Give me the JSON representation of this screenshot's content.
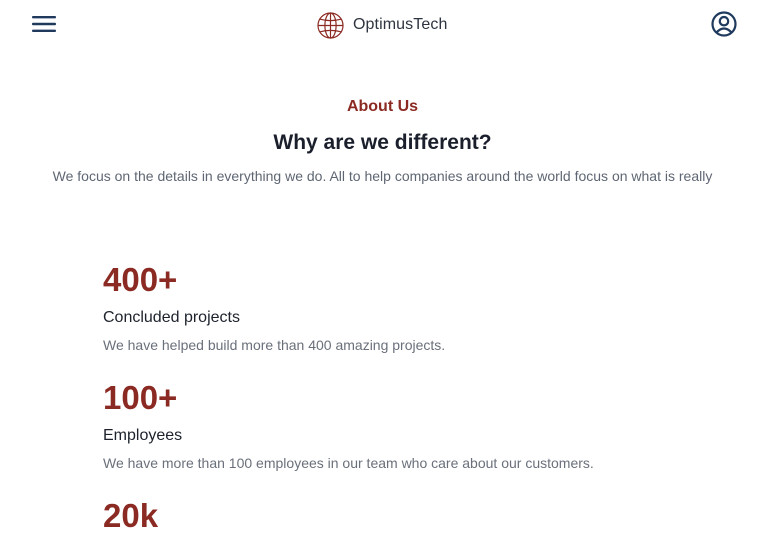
{
  "header": {
    "brand_name": "OptimusTech",
    "menu_icon": "hamburger-menu-icon",
    "logo_icon": "globe-icon",
    "account_icon": "user-circle-icon"
  },
  "hero": {
    "eyebrow": "About Us",
    "title": "Why are we different?",
    "description": "We focus on the details in everything we do. All to help companies around the world focus on what is really"
  },
  "stats": [
    {
      "value": "400+",
      "title": "Concluded projects",
      "description": "We have helped build more than 400 amazing projects."
    },
    {
      "value": "100+",
      "title": "Employees",
      "description": "We have more than 100 employees in our team who care about our customers."
    },
    {
      "value": "20k",
      "title": "",
      "description": ""
    }
  ],
  "colors": {
    "accent": "#8b2a22",
    "heading": "#1a1f2b",
    "muted_text": "#6a707b",
    "icon_dark": "#1f3a5c",
    "background": "#ffffff"
  }
}
